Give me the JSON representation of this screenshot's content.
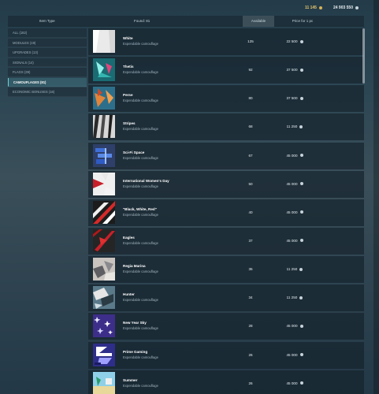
{
  "currency": {
    "gold": "11 145",
    "silver": "24 903 550"
  },
  "columns": {
    "item_type": "Item Type",
    "found": "Found: 81",
    "available": "Available",
    "price": "Price for 1 pc"
  },
  "filters": [
    {
      "label": "ALL (182)",
      "active": false
    },
    {
      "label": "MODULES (19)",
      "active": false
    },
    {
      "label": "UPGRADES (13)",
      "active": false
    },
    {
      "label": "SIGNALS (14)",
      "active": false
    },
    {
      "label": "FLAGS (39)",
      "active": false
    },
    {
      "label": "CAMOUFLAGES (81)",
      "active": true
    },
    {
      "label": "ECONOMIC BONUSES (16)",
      "active": false
    }
  ],
  "items": [
    {
      "name": "White",
      "type": "Expendable camouflage",
      "available": "125",
      "price": "22 500",
      "icon": "white-camo"
    },
    {
      "name": "Thetis",
      "type": "Expendable camouflage",
      "available": "92",
      "price": "37 500",
      "icon": "thetis-camo"
    },
    {
      "name": "Perse",
      "type": "Expendable camouflage",
      "available": "80",
      "price": "37 500",
      "icon": "perse-camo"
    },
    {
      "name": "Stripes",
      "type": "Expendable camouflage",
      "available": "68",
      "price": "11 250",
      "icon": "stripes-camo"
    },
    {
      "name": "Sci-Fi Space",
      "type": "Expendable camouflage",
      "available": "67",
      "price": "45 000",
      "icon": "scifi-camo"
    },
    {
      "name": "International Women's Day",
      "type": "Expendable camouflage",
      "available": "50",
      "price": "45 000",
      "icon": "womens-day-camo"
    },
    {
      "name": "\"Black, White, Red\"",
      "type": "Expendable camouflage",
      "available": "40",
      "price": "45 000",
      "icon": "bwr-camo"
    },
    {
      "name": "Eagles",
      "type": "Expendable camouflage",
      "available": "37",
      "price": "45 000",
      "icon": "eagles-camo"
    },
    {
      "name": "Regia Marina",
      "type": "Expendable camouflage",
      "available": "35",
      "price": "11 250",
      "icon": "regia-marina-camo"
    },
    {
      "name": "Hunter",
      "type": "Expendable camouflage",
      "available": "34",
      "price": "11 250",
      "icon": "hunter-camo"
    },
    {
      "name": "New Year Sky",
      "type": "Expendable camouflage",
      "available": "28",
      "price": "45 000",
      "icon": "new-year-sky-camo"
    },
    {
      "name": "Prime Gaming",
      "type": "Expendable camouflage",
      "available": "26",
      "price": "45 000",
      "icon": "prime-gaming-camo"
    },
    {
      "name": "Summer",
      "type": "Expendable camouflage",
      "available": "26",
      "price": "45 000",
      "icon": "summer-camo"
    }
  ]
}
